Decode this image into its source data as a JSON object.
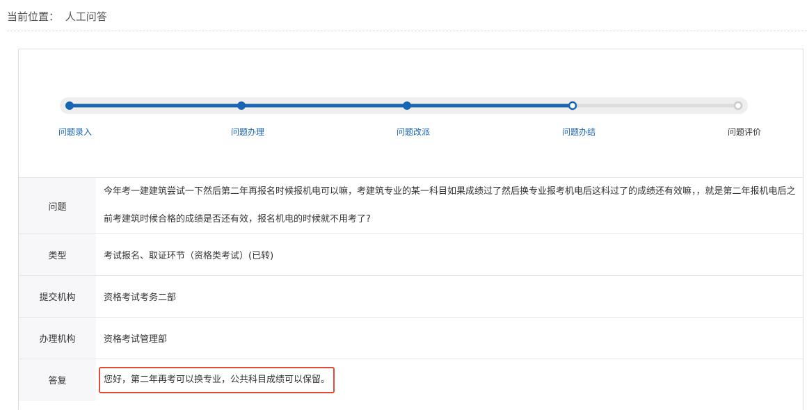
{
  "breadcrumb": {
    "prefix": "当前位置：",
    "current": "人工问答"
  },
  "progress": {
    "steps": [
      {
        "label": "问题录入",
        "state": "done"
      },
      {
        "label": "问题办理",
        "state": "done"
      },
      {
        "label": "问题改派",
        "state": "done"
      },
      {
        "label": "问题办结",
        "state": "current"
      },
      {
        "label": "问题评价",
        "state": "pending"
      }
    ],
    "completed_fraction": 0.75,
    "colors": {
      "active": "#1a64b4",
      "track": "#e6e6e6",
      "pending_dot": "#cccccc"
    }
  },
  "details": {
    "question_label": "问题",
    "question_text": "今年考一建建筑尝试一下然后第二年再报名时候报机电可以嘛，考建筑专业的某一科目如果成绩过了然后换专业报考机电后这科过了的成绩还有效嘛，，就是第二年报机电后之前考建筑时候合格的成绩是否还有效，报名机电的时候就不用考了?",
    "type_label": "类型",
    "type_value": "考试报名、取证环节（资格类考试）(已转)",
    "submit_org_label": "提交机构",
    "submit_org_value": "资格考试考务二部",
    "handle_org_label": "办理机构",
    "handle_org_value": "资格考试管理部",
    "answer_label": "答复",
    "answer_value": "您好，第二年再考可以换专业，公共科目成绩可以保留。"
  },
  "highlight_color": "#e04a3a"
}
